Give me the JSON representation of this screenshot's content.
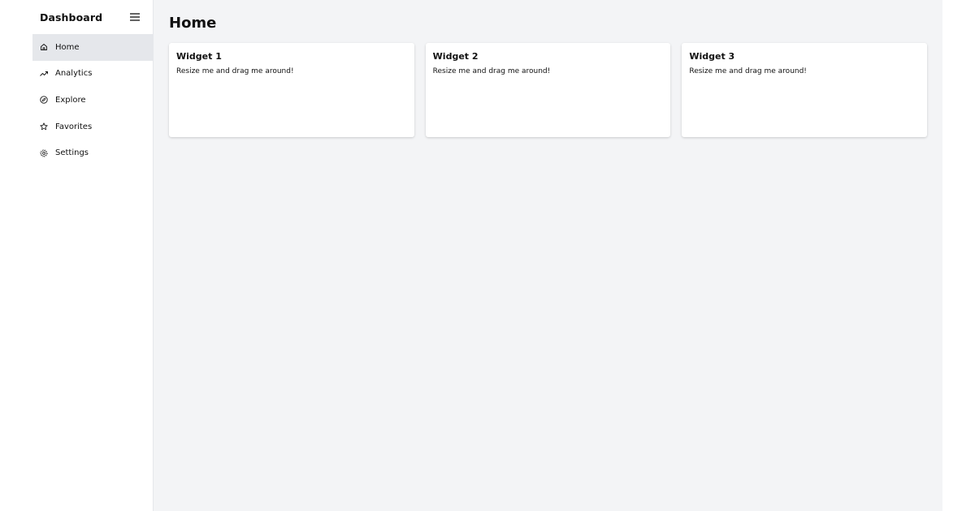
{
  "sidebar": {
    "brand": "Dashboard",
    "toggle_icon": "hamburger-menu-icon",
    "items": [
      {
        "label": "Home",
        "icon": "home-icon",
        "active": true
      },
      {
        "label": "Analytics",
        "icon": "trending-up-icon",
        "active": false
      },
      {
        "label": "Explore",
        "icon": "compass-icon",
        "active": false
      },
      {
        "label": "Favorites",
        "icon": "star-icon",
        "active": false
      },
      {
        "label": "Settings",
        "icon": "gear-icon",
        "active": false
      }
    ]
  },
  "main": {
    "title": "Home",
    "widgets": [
      {
        "title": "Widget 1",
        "text": "Resize me and drag me around!"
      },
      {
        "title": "Widget 2",
        "text": "Resize me and drag me around!"
      },
      {
        "title": "Widget 3",
        "text": "Resize me and drag me around!"
      }
    ]
  },
  "colors": {
    "sidebar_bg": "#ffffff",
    "active_item_bg": "#e5e7eb",
    "main_bg": "#f3f4f6",
    "widget_bg": "#ffffff",
    "text": "#111111"
  }
}
